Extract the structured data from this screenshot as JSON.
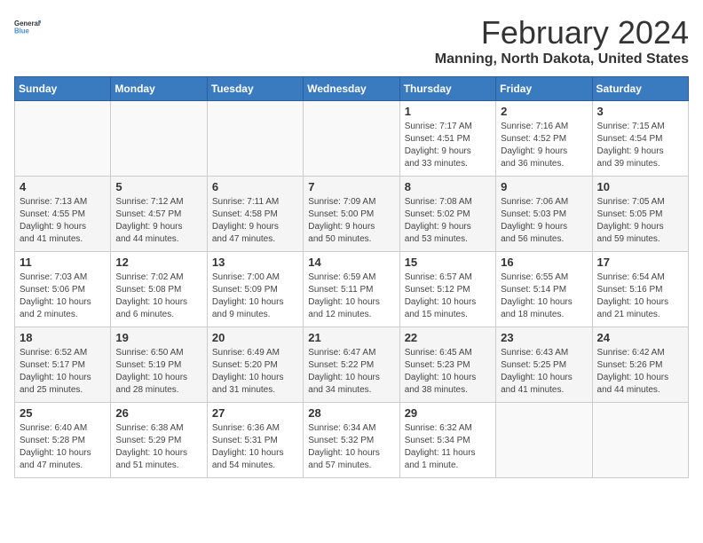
{
  "header": {
    "logo_general": "General",
    "logo_blue": "Blue",
    "month_title": "February 2024",
    "location": "Manning, North Dakota, United States"
  },
  "days_of_week": [
    "Sunday",
    "Monday",
    "Tuesday",
    "Wednesday",
    "Thursday",
    "Friday",
    "Saturday"
  ],
  "weeks": [
    [
      {
        "day": "",
        "info": ""
      },
      {
        "day": "",
        "info": ""
      },
      {
        "day": "",
        "info": ""
      },
      {
        "day": "",
        "info": ""
      },
      {
        "day": "1",
        "info": "Sunrise: 7:17 AM\nSunset: 4:51 PM\nDaylight: 9 hours\nand 33 minutes."
      },
      {
        "day": "2",
        "info": "Sunrise: 7:16 AM\nSunset: 4:52 PM\nDaylight: 9 hours\nand 36 minutes."
      },
      {
        "day": "3",
        "info": "Sunrise: 7:15 AM\nSunset: 4:54 PM\nDaylight: 9 hours\nand 39 minutes."
      }
    ],
    [
      {
        "day": "4",
        "info": "Sunrise: 7:13 AM\nSunset: 4:55 PM\nDaylight: 9 hours\nand 41 minutes."
      },
      {
        "day": "5",
        "info": "Sunrise: 7:12 AM\nSunset: 4:57 PM\nDaylight: 9 hours\nand 44 minutes."
      },
      {
        "day": "6",
        "info": "Sunrise: 7:11 AM\nSunset: 4:58 PM\nDaylight: 9 hours\nand 47 minutes."
      },
      {
        "day": "7",
        "info": "Sunrise: 7:09 AM\nSunset: 5:00 PM\nDaylight: 9 hours\nand 50 minutes."
      },
      {
        "day": "8",
        "info": "Sunrise: 7:08 AM\nSunset: 5:02 PM\nDaylight: 9 hours\nand 53 minutes."
      },
      {
        "day": "9",
        "info": "Sunrise: 7:06 AM\nSunset: 5:03 PM\nDaylight: 9 hours\nand 56 minutes."
      },
      {
        "day": "10",
        "info": "Sunrise: 7:05 AM\nSunset: 5:05 PM\nDaylight: 9 hours\nand 59 minutes."
      }
    ],
    [
      {
        "day": "11",
        "info": "Sunrise: 7:03 AM\nSunset: 5:06 PM\nDaylight: 10 hours\nand 2 minutes."
      },
      {
        "day": "12",
        "info": "Sunrise: 7:02 AM\nSunset: 5:08 PM\nDaylight: 10 hours\nand 6 minutes."
      },
      {
        "day": "13",
        "info": "Sunrise: 7:00 AM\nSunset: 5:09 PM\nDaylight: 10 hours\nand 9 minutes."
      },
      {
        "day": "14",
        "info": "Sunrise: 6:59 AM\nSunset: 5:11 PM\nDaylight: 10 hours\nand 12 minutes."
      },
      {
        "day": "15",
        "info": "Sunrise: 6:57 AM\nSunset: 5:12 PM\nDaylight: 10 hours\nand 15 minutes."
      },
      {
        "day": "16",
        "info": "Sunrise: 6:55 AM\nSunset: 5:14 PM\nDaylight: 10 hours\nand 18 minutes."
      },
      {
        "day": "17",
        "info": "Sunrise: 6:54 AM\nSunset: 5:16 PM\nDaylight: 10 hours\nand 21 minutes."
      }
    ],
    [
      {
        "day": "18",
        "info": "Sunrise: 6:52 AM\nSunset: 5:17 PM\nDaylight: 10 hours\nand 25 minutes."
      },
      {
        "day": "19",
        "info": "Sunrise: 6:50 AM\nSunset: 5:19 PM\nDaylight: 10 hours\nand 28 minutes."
      },
      {
        "day": "20",
        "info": "Sunrise: 6:49 AM\nSunset: 5:20 PM\nDaylight: 10 hours\nand 31 minutes."
      },
      {
        "day": "21",
        "info": "Sunrise: 6:47 AM\nSunset: 5:22 PM\nDaylight: 10 hours\nand 34 minutes."
      },
      {
        "day": "22",
        "info": "Sunrise: 6:45 AM\nSunset: 5:23 PM\nDaylight: 10 hours\nand 38 minutes."
      },
      {
        "day": "23",
        "info": "Sunrise: 6:43 AM\nSunset: 5:25 PM\nDaylight: 10 hours\nand 41 minutes."
      },
      {
        "day": "24",
        "info": "Sunrise: 6:42 AM\nSunset: 5:26 PM\nDaylight: 10 hours\nand 44 minutes."
      }
    ],
    [
      {
        "day": "25",
        "info": "Sunrise: 6:40 AM\nSunset: 5:28 PM\nDaylight: 10 hours\nand 47 minutes."
      },
      {
        "day": "26",
        "info": "Sunrise: 6:38 AM\nSunset: 5:29 PM\nDaylight: 10 hours\nand 51 minutes."
      },
      {
        "day": "27",
        "info": "Sunrise: 6:36 AM\nSunset: 5:31 PM\nDaylight: 10 hours\nand 54 minutes."
      },
      {
        "day": "28",
        "info": "Sunrise: 6:34 AM\nSunset: 5:32 PM\nDaylight: 10 hours\nand 57 minutes."
      },
      {
        "day": "29",
        "info": "Sunrise: 6:32 AM\nSunset: 5:34 PM\nDaylight: 11 hours\nand 1 minute."
      },
      {
        "day": "",
        "info": ""
      },
      {
        "day": "",
        "info": ""
      }
    ]
  ]
}
